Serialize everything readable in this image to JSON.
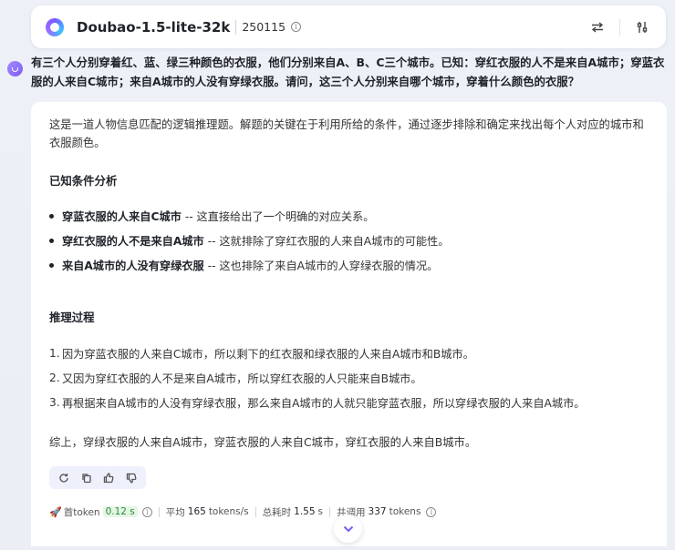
{
  "header": {
    "model_name": "Doubao-1.5-lite-32k",
    "version": "250115",
    "info_glyph": "i"
  },
  "question": "有三个人分别穿着红、蓝、绿三种颜色的衣服，他们分别来自A、B、C三个城市。已知：穿红衣服的人不是来自A城市；穿蓝衣服的人来自C城市；来自A城市的人没有穿绿衣服。请问，这三个人分别来自哪个城市，穿着什么颜色的衣服？",
  "answer": {
    "intro": "这是一道人物信息匹配的逻辑推理题。解题的关键在于利用所给的条件，通过逐步排除和确定来找出每个人对应的城市和衣服颜色。",
    "section1_title": "已知条件分析",
    "conditions": [
      {
        "bold": "穿蓝衣服的人来自C城市",
        "text": "-- 这直接给出了一个明确的对应关系。"
      },
      {
        "bold": "穿红衣服的人不是来自A城市",
        "text": "-- 这就排除了穿红衣服的人来自A城市的可能性。"
      },
      {
        "bold": "来自A城市的人没有穿绿衣服",
        "text": "-- 这也排除了来自A城市的人穿绿衣服的情况。"
      }
    ],
    "section2_title": "推理过程",
    "steps": [
      {
        "n": "1.",
        "text": "因为穿蓝衣服的人来自C城市，所以剩下的红衣服和绿衣服的人来自A城市和B城市。"
      },
      {
        "n": "2.",
        "text": "又因为穿红衣服的人不是来自A城市，所以穿红衣服的人只能来自B城市。"
      },
      {
        "n": "3.",
        "text": "再根据来自A城市的人没有穿绿衣服，那么来自A城市的人就只能穿蓝衣服，所以穿绿衣服的人来自A城市。"
      }
    ],
    "conclusion": "综上，穿绿衣服的人来自A城市，穿蓝衣服的人来自C城市，穿红衣服的人来自B城市。"
  },
  "stats": {
    "first_token_label": "首token",
    "first_token_value": "0.12 s",
    "avg_label": "平均",
    "avg_value": "165",
    "avg_unit": "tokens/s",
    "total_time_label": "总耗时",
    "total_time_value": "1.55",
    "total_time_unit": "s",
    "total_call_label": "共调用",
    "total_call_value": "337",
    "total_call_unit": "tokens"
  },
  "icons": {
    "swap": "swap-icon",
    "settings": "sliders-icon",
    "regenerate": "refresh-icon",
    "copy": "copy-icon",
    "like": "thumbs-up-icon",
    "dislike": "thumbs-down-icon",
    "scroll_down": "chevron-down-icon"
  },
  "colors": {
    "accent": "#7a5cf5",
    "token_badge_bg": "#e4f6e4",
    "token_badge_text": "#2e8b3e"
  }
}
